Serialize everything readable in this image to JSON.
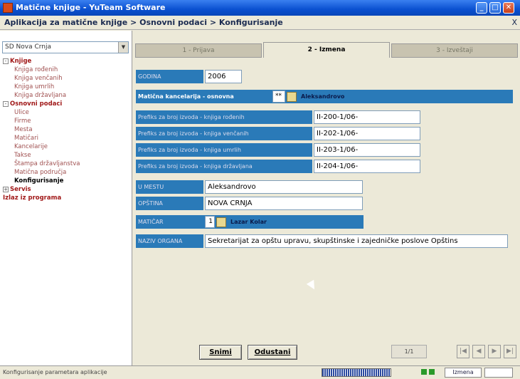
{
  "window": {
    "title": "Matične knjige - YuTeam Software"
  },
  "breadcrumb": {
    "text": "Aplikacija za matične knjige > Osnovni podaci > Konfigurisanje",
    "close": "X"
  },
  "sidebar": {
    "combo_value": "SD Nova Crnja",
    "tree": [
      {
        "label": "Knjige",
        "level": 0,
        "expander": "-"
      },
      {
        "label": "Knjiga rođenih",
        "level": 1
      },
      {
        "label": "Knjiga venčanih",
        "level": 1
      },
      {
        "label": "Knjiga umrlih",
        "level": 1
      },
      {
        "label": "Knjiga državljana",
        "level": 1
      },
      {
        "label": "Osnovni podaci",
        "level": 0,
        "expander": "-"
      },
      {
        "label": "Ulice",
        "level": 1
      },
      {
        "label": "Firme",
        "level": 1
      },
      {
        "label": "Mesta",
        "level": 1
      },
      {
        "label": "Matičari",
        "level": 1
      },
      {
        "label": "Kancelarije",
        "level": 1
      },
      {
        "label": "Takse",
        "level": 1
      },
      {
        "label": "Štampa državljanstva",
        "level": 1
      },
      {
        "label": "Matična područja",
        "level": 1
      },
      {
        "label": "Konfigurisanje",
        "level": 1,
        "selected": true
      },
      {
        "label": "Servis",
        "level": 0,
        "expander": "+"
      },
      {
        "label": "Izlaz iz programa",
        "level": 0
      }
    ]
  },
  "tabs": [
    "1 - Prijava",
    "2 - Izmena",
    "3 - Izveštaji"
  ],
  "form": {
    "godina_label": "GODINA",
    "godina_value": "2006",
    "kancelarija_label": "Matična kancelarija - osnovna",
    "kancelarija_code": "**",
    "kancelarija_name": "Aleksandrovo",
    "prefix_rodjenih_label": "Prefiks za broj izvoda - knjiga rođenih",
    "prefix_rodjenih_value": "II-200-1/06-",
    "prefix_vencanih_label": "Prefiks za broj izvoda - knjiga venčanih",
    "prefix_vencanih_value": "II-202-1/06-",
    "prefix_umrlih_label": "Prefiks za broj izvoda - knjiga umrlih",
    "prefix_umrlih_value": "II-203-1/06-",
    "prefix_drzavljana_label": "Prefiks za broj izvoda - knjiga državljana",
    "prefix_drzavljana_value": "II-204-1/06-",
    "mestu_label": "U MESTU",
    "mestu_value": "Aleksandrovo",
    "opstina_label": "OPŠTINA",
    "opstina_value": "NOVA CRNJA",
    "maticar_label": "MATIČAR",
    "maticar_code": "1",
    "maticar_name": "Lazar Kolar",
    "organ_label": "NAZIV ORGANA",
    "organ_value": "Sekretarijat za opštu upravu, skupštinske i zajedničke poslove Opštins"
  },
  "buttons": {
    "save": "Snimi",
    "cancel": "Odustani"
  },
  "pager": {
    "indicator": "1/1"
  },
  "status": {
    "text": "Konfigurisanje parametara aplikacije",
    "mode": "Izmena"
  }
}
